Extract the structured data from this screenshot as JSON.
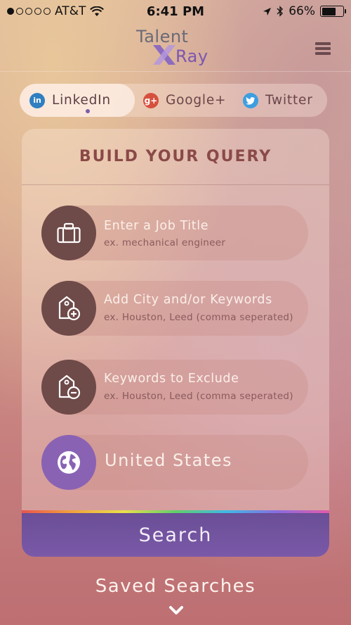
{
  "status_bar": {
    "carrier": "AT&T",
    "time": "6:41 PM",
    "battery": "66%",
    "battery_level": 0.66
  },
  "header": {
    "logo_line1": "Talent",
    "logo_line2": "Ray"
  },
  "tabs": [
    {
      "label": "LinkedIn",
      "icon": "linkedin-icon",
      "active": true
    },
    {
      "label": "Google+",
      "icon": "google-plus-icon",
      "active": false
    },
    {
      "label": "Twitter",
      "icon": "twitter-icon",
      "active": false
    }
  ],
  "query": {
    "title": "BUILD YOUR QUERY",
    "fields": [
      {
        "label": "Enter a Job Title",
        "hint": "ex. mechanical engineer",
        "icon": "briefcase-icon"
      },
      {
        "label": "Add City and/or Keywords",
        "hint": "ex. Houston, Leed (comma seperated)",
        "icon": "tag-add-icon"
      },
      {
        "label": "Keywords to Exclude",
        "hint": "ex. Houston, Leed (comma seperated)",
        "icon": "tag-remove-icon"
      }
    ],
    "country": "United States",
    "search_label": "Search"
  },
  "footer": {
    "saved_label": "Saved Searches"
  },
  "colors": {
    "field_icon": "#6e4a48",
    "globe_icon": "#8a62b4",
    "search_button": "#6a4e96",
    "title": "#8a4a48"
  }
}
